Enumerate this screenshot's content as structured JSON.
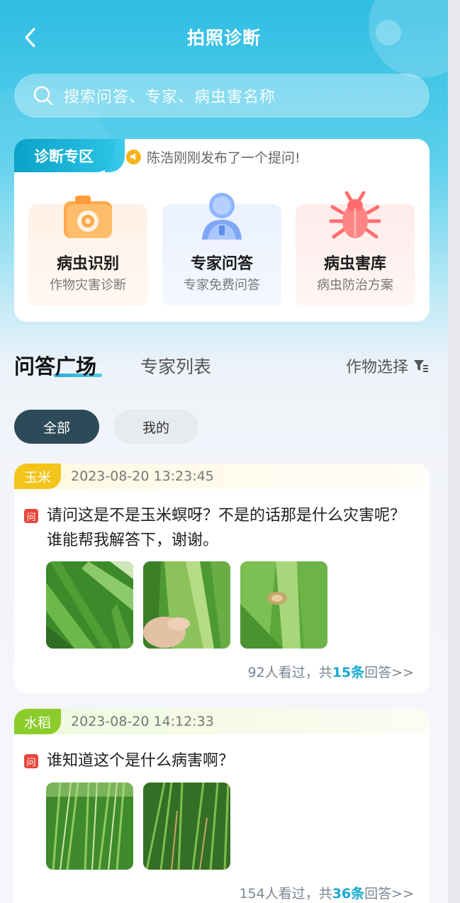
{
  "header": {
    "title": "拍照诊断",
    "search_placeholder": "搜索问答、专家、病虫害名称"
  },
  "diagnosis": {
    "tab_label": "诊断专区",
    "notice": "陈浩刚刚发布了一个提问!",
    "features": [
      {
        "title": "病虫识别",
        "subtitle": "作物灾害诊断",
        "icon": "camera-icon"
      },
      {
        "title": "专家问答",
        "subtitle": "专家免费问答",
        "icon": "expert-icon"
      },
      {
        "title": "病虫害库",
        "subtitle": "病虫防治方案",
        "icon": "bug-icon"
      }
    ]
  },
  "tabs": {
    "qa": "问答广场",
    "experts": "专家列表",
    "crop_select": "作物选择"
  },
  "filters": {
    "all": "全部",
    "mine": "我的"
  },
  "questions": [
    {
      "crop": "玉米",
      "crop_color": "#f3c51a",
      "time": "2023-08-20 13:23:45",
      "badge": "问",
      "text": "请问这是不是玉米螟呀？不是的话那是什么灾害呢？谁能帮我解答下，谢谢。",
      "views_prefix": "92人看过，共",
      "answers": "15条",
      "suffix": "回答>>"
    },
    {
      "crop": "水稻",
      "crop_color": "#8ccc2a",
      "time": "2023-08-20 14:12:33",
      "badge": "问",
      "text": "谁知道这个是什么病害啊？",
      "views_prefix": "154人看过，共",
      "answers": "36条",
      "suffix": "回答>>"
    }
  ]
}
